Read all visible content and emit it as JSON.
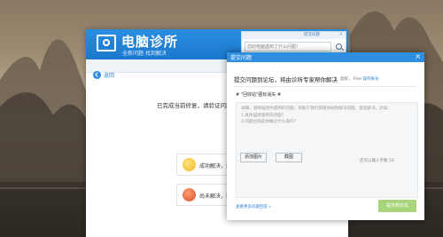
{
  "app": {
    "title": "电脑诊所",
    "subtitle": "全新问题 找到解决"
  },
  "main": {
    "back_label": "返回",
    "repair_done_text": "已完成当前修复，请验证问题",
    "options": [
      {
        "label": "成功解决，返",
        "icon": "happy-face-icon"
      },
      {
        "label": "尚未解决，我",
        "icon": "sad-face-icon"
      }
    ]
  },
  "search": {
    "top_label": "提交问题",
    "close": "×",
    "input_value": "您的电脑遇到了什么问题？"
  },
  "dialog": {
    "title": "提交问题",
    "close": "×",
    "heading": "提交问题到论坛，将由诊所专家帮你解决",
    "user_name": "您好，",
    "user_id": "Fine",
    "user_link": "操作帐号",
    "question_title": "# \"回收站\"图标消失 #",
    "body_placeholder": [
      "详细、清晰描述你遇到的问题，有助于我们快速协助你解决问题，帮您解决，比如：",
      "1.具体描述遇到的问题？",
      "2.问题出现前你做过什么操作？"
    ],
    "add_image_label": "添加图片",
    "screenshot_label": "截图",
    "word_limit": "还可以输入字数 10",
    "forum_link": "查看更多问题回答 »",
    "submit_label": "提交到论坛"
  },
  "colors": {
    "header_blue": "#2a8ee0",
    "link_blue": "#2b7fd0",
    "submit_green": "#a8d57a"
  }
}
